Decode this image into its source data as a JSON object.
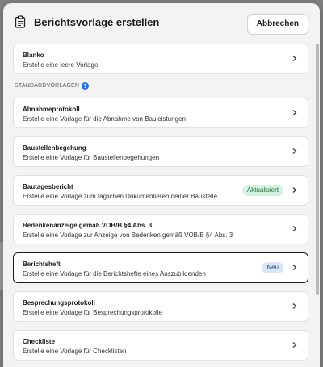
{
  "dialog": {
    "title": "Berichtsvorlage erstellen",
    "cancel_label": "Abbrechen"
  },
  "blank": {
    "title": "Blanko",
    "description": "Erstelle eine leere Vorlage"
  },
  "section": {
    "label": "STANDARDVORLAGEN"
  },
  "templates": [
    {
      "title": "Abnahmeprotokoll",
      "description": "Erstelle eine Vorlage für die Abnahme von Bauleistungen"
    },
    {
      "title": "Baustellenbegehung",
      "description": "Erstelle eine Vorlage für Baustellenbegehungen"
    },
    {
      "title": "Bautagesbericht",
      "description": "Erstelle eine Vorlage zum täglichen Dokumentieren deiner Baustelle",
      "badge": "Aktualisiert"
    },
    {
      "title": "Bedenkenanzeige gemäß VOB/B §4 Abs. 3",
      "description": "Erstelle eine Vorlage zur Anzeige von Bedenken gemäß VOB/B §4 Abs. 3"
    },
    {
      "title": "Berichtsheft",
      "description": "Erstelle eine Vorlage für die Berichtshefte eines Auszubildenden",
      "badge": "Neu"
    },
    {
      "title": "Besprechungsprotokoll",
      "description": "Erstelle eine Vorlage für Besprechungsprotokolle"
    },
    {
      "title": "Checkliste",
      "description": "Erstelle eine Vorlage für Checklisten"
    }
  ],
  "colors": {
    "badge_updated_bg": "#d6f2e1",
    "badge_new_bg": "#d9e6f8",
    "help_icon": "#2b6fd6"
  },
  "icons": {
    "title": "clipboard-icon",
    "help": "question-circle-icon",
    "row_arrow": "chevron-right-icon"
  }
}
